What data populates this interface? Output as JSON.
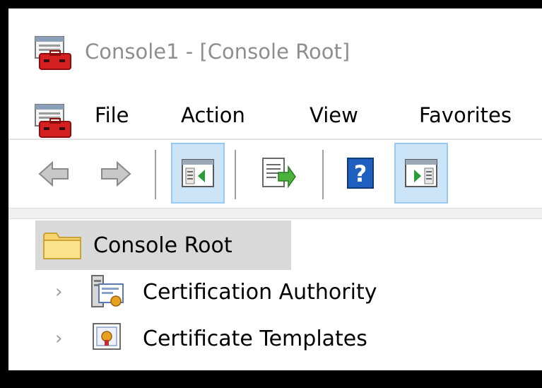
{
  "window": {
    "title": "Console1 - [Console Root]"
  },
  "menu": {
    "items": [
      "File",
      "Action",
      "View",
      "Favorites"
    ]
  },
  "toolbar": {
    "buttons": [
      "back",
      "forward",
      "show-hide-console-tree",
      "export-list",
      "help",
      "show-hide-action-pane"
    ]
  },
  "tree": {
    "root": "Console Root",
    "children": [
      "Certification Authority",
      "Certificate Templates"
    ]
  },
  "colors": {
    "title_text": "#8e8e8e",
    "selection": "#d9d9d9",
    "toolbar_highlight": "#cce4f7"
  }
}
